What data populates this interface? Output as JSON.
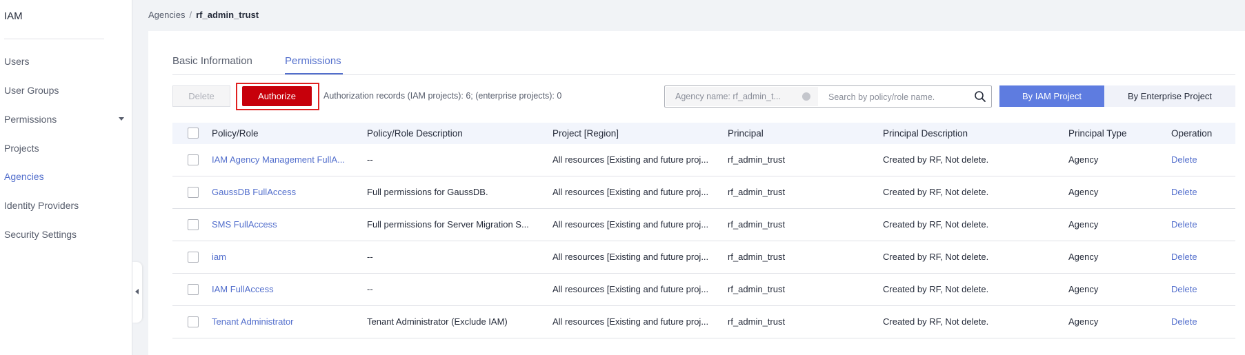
{
  "sidebar": {
    "title": "IAM",
    "items": [
      {
        "label": "Users"
      },
      {
        "label": "User Groups"
      },
      {
        "label": "Permissions"
      },
      {
        "label": "Projects"
      },
      {
        "label": "Agencies"
      },
      {
        "label": "Identity Providers"
      },
      {
        "label": "Security Settings"
      }
    ]
  },
  "breadcrumb": {
    "parent": "Agencies",
    "separator": "/",
    "current": "rf_admin_trust"
  },
  "tabs": [
    {
      "label": "Basic Information"
    },
    {
      "label": "Permissions"
    }
  ],
  "toolbar": {
    "delete_label": "Delete",
    "authorize_label": "Authorize",
    "records_text": "Authorization records (IAM projects): 6; (enterprise projects): 0",
    "filter_tag": "Agency name: rf_admin_t...",
    "search_placeholder": "Search by policy/role name.",
    "by_iam_label": "By IAM Project",
    "by_enterprise_label": "By Enterprise Project"
  },
  "table": {
    "columns": [
      "Policy/Role",
      "Policy/Role Description",
      "Project [Region]",
      "Principal",
      "Principal Description",
      "Principal Type",
      "Operation"
    ],
    "rows": [
      {
        "policy": "IAM Agency Management FullA...",
        "description": "--",
        "project": "All resources [Existing and future proj...",
        "principal": "rf_admin_trust",
        "principal_desc": "Created by RF, Not delete.",
        "type": "Agency",
        "op": "Delete"
      },
      {
        "policy": "GaussDB FullAccess",
        "description": "Full permissions for GaussDB.",
        "project": "All resources [Existing and future proj...",
        "principal": "rf_admin_trust",
        "principal_desc": "Created by RF, Not delete.",
        "type": "Agency",
        "op": "Delete"
      },
      {
        "policy": "SMS FullAccess",
        "description": "Full permissions for Server Migration S...",
        "project": "All resources [Existing and future proj...",
        "principal": "rf_admin_trust",
        "principal_desc": "Created by RF, Not delete.",
        "type": "Agency",
        "op": "Delete"
      },
      {
        "policy": "iam",
        "description": "--",
        "project": "All resources [Existing and future proj...",
        "principal": "rf_admin_trust",
        "principal_desc": "Created by RF, Not delete.",
        "type": "Agency",
        "op": "Delete"
      },
      {
        "policy": "IAM FullAccess",
        "description": "--",
        "project": "All resources [Existing and future proj...",
        "principal": "rf_admin_trust",
        "principal_desc": "Created by RF, Not delete.",
        "type": "Agency",
        "op": "Delete"
      },
      {
        "policy": "Tenant Administrator",
        "description": "Tenant Administrator (Exclude IAM)",
        "project": "All resources [Existing and future proj...",
        "principal": "rf_admin_trust",
        "principal_desc": "Created by RF, Not delete.",
        "type": "Agency",
        "op": "Delete"
      }
    ]
  },
  "colors": {
    "accent": "#526ecc",
    "primary_red": "#c7000b",
    "highlight_border": "#e02020",
    "iam_button": "#5e7ce0"
  }
}
